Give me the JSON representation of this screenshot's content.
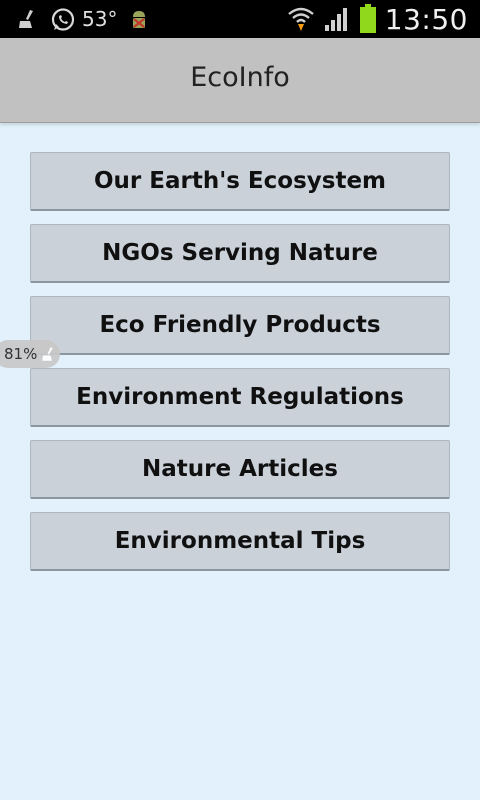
{
  "status_bar": {
    "temperature": "53°",
    "time": "13:50",
    "icons": [
      "broom-icon",
      "whatsapp-icon",
      "android-debug-icon",
      "wifi-icon",
      "signal-icon",
      "battery-icon"
    ]
  },
  "app": {
    "title": "EcoInfo"
  },
  "menu": {
    "items": [
      {
        "label": "Our Earth's Ecosystem"
      },
      {
        "label": "NGOs Serving Nature"
      },
      {
        "label": "Eco Friendly Products"
      },
      {
        "label": "Environment Regulations"
      },
      {
        "label": "Nature Articles"
      },
      {
        "label": "Environmental Tips"
      }
    ]
  },
  "overlay": {
    "battery_percent": "81%"
  },
  "colors": {
    "background": "#e2f1fc",
    "action_bar": "#c1c1c1",
    "button": "#cad1d9",
    "battery_accent": "#8fd81c"
  }
}
